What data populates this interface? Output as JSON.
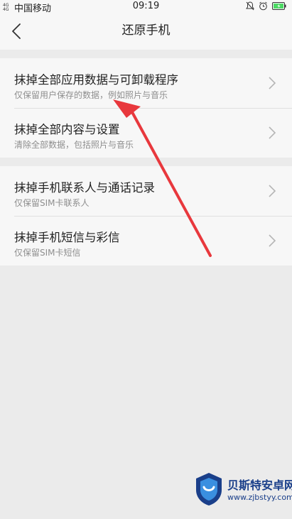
{
  "status_bar": {
    "network": "4G 4G",
    "carrier": "中国移动",
    "time": "09:19",
    "icons": [
      "bell-off-icon",
      "alarm-icon",
      "battery-icon"
    ]
  },
  "header": {
    "back_icon": "chevron-left-icon",
    "title": "还原手机"
  },
  "groups": [
    {
      "items": [
        {
          "title": "抹掉全部应用数据与可卸载程序",
          "subtitle": "仅保留用户保存的数据，例如照片与音乐"
        },
        {
          "title": "抹掉全部内容与设置",
          "subtitle": "清除全部数据，包括照片与音乐"
        }
      ]
    },
    {
      "items": [
        {
          "title": "抹掉手机联系人与通话记录",
          "subtitle": "仅保留SIM卡联系人"
        },
        {
          "title": "抹掉手机短信与彩信",
          "subtitle": "仅保留SIM卡短信"
        }
      ]
    }
  ],
  "annotation": {
    "color": "#e8383d"
  },
  "watermark": {
    "name": "贝斯特安卓网",
    "url": "www.zjbstyy.com",
    "color": "#1a3f8a"
  }
}
